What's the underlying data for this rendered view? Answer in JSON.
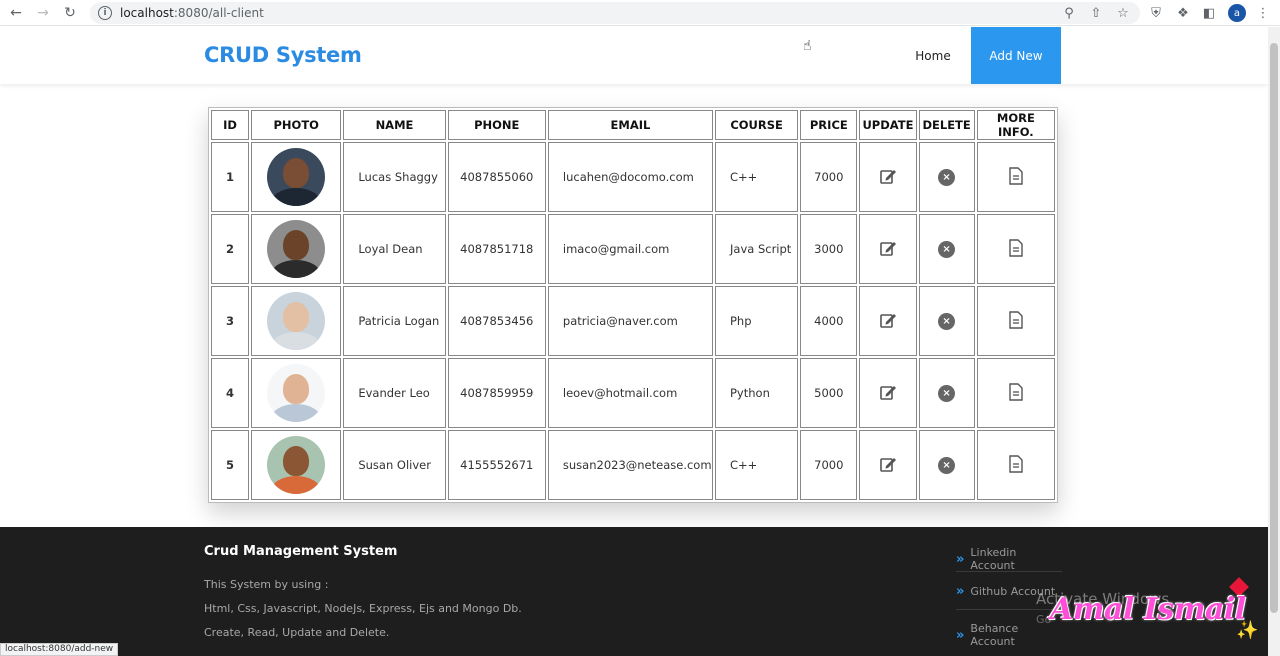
{
  "browser": {
    "url_host": "localhost",
    "url_path": ":8080/all-client",
    "profile_initial": "a",
    "status_url": "localhost:8080/add-new"
  },
  "header": {
    "brand": "CRUD System",
    "nav_home": "Home",
    "nav_add": "Add New"
  },
  "table": {
    "headers": [
      "ID",
      "PHOTO",
      "NAME",
      "PHONE",
      "EMAIL",
      "COURSE",
      "PRICE",
      "UPDATE",
      "DELETE",
      "MORE INFO."
    ],
    "rows": [
      {
        "id": "1",
        "name": "Lucas Shaggy",
        "phone": "4087855060",
        "email": "lucahen@docomo.com",
        "course": "C++",
        "price": "7000"
      },
      {
        "id": "2",
        "name": "Loyal Dean",
        "phone": "4087851718",
        "email": "imaco@gmail.com",
        "course": "Java Script",
        "price": "3000"
      },
      {
        "id": "3",
        "name": "Patricia Logan",
        "phone": "4087853456",
        "email": "patricia@naver.com",
        "course": "Php",
        "price": "4000"
      },
      {
        "id": "4",
        "name": "Evander Leo",
        "phone": "4087859959",
        "email": "leoev@hotmail.com",
        "course": "Python",
        "price": "5000"
      },
      {
        "id": "5",
        "name": "Susan Oliver",
        "phone": "4155552671",
        "email": "susan2023@netease.com",
        "course": "C++",
        "price": "7000"
      }
    ]
  },
  "footer": {
    "title": "Crud Management System",
    "line1": "This System by using :",
    "line2": "Html, Css, Javascript, NodeJs, Express, Ejs and Mongo Db.",
    "line3": "Create, Read, Update and Delete.",
    "links": [
      "Linkedin Account",
      "Github Account",
      "Behance Account"
    ]
  },
  "overlay": {
    "watermark_line1": "Activate Windows",
    "watermark_line2": "Go",
    "signature": "Amal Ismail"
  },
  "colors": {
    "accent": "#2b97ef",
    "brand": "#2b8be3",
    "footer_bg": "#1e1e1e"
  }
}
